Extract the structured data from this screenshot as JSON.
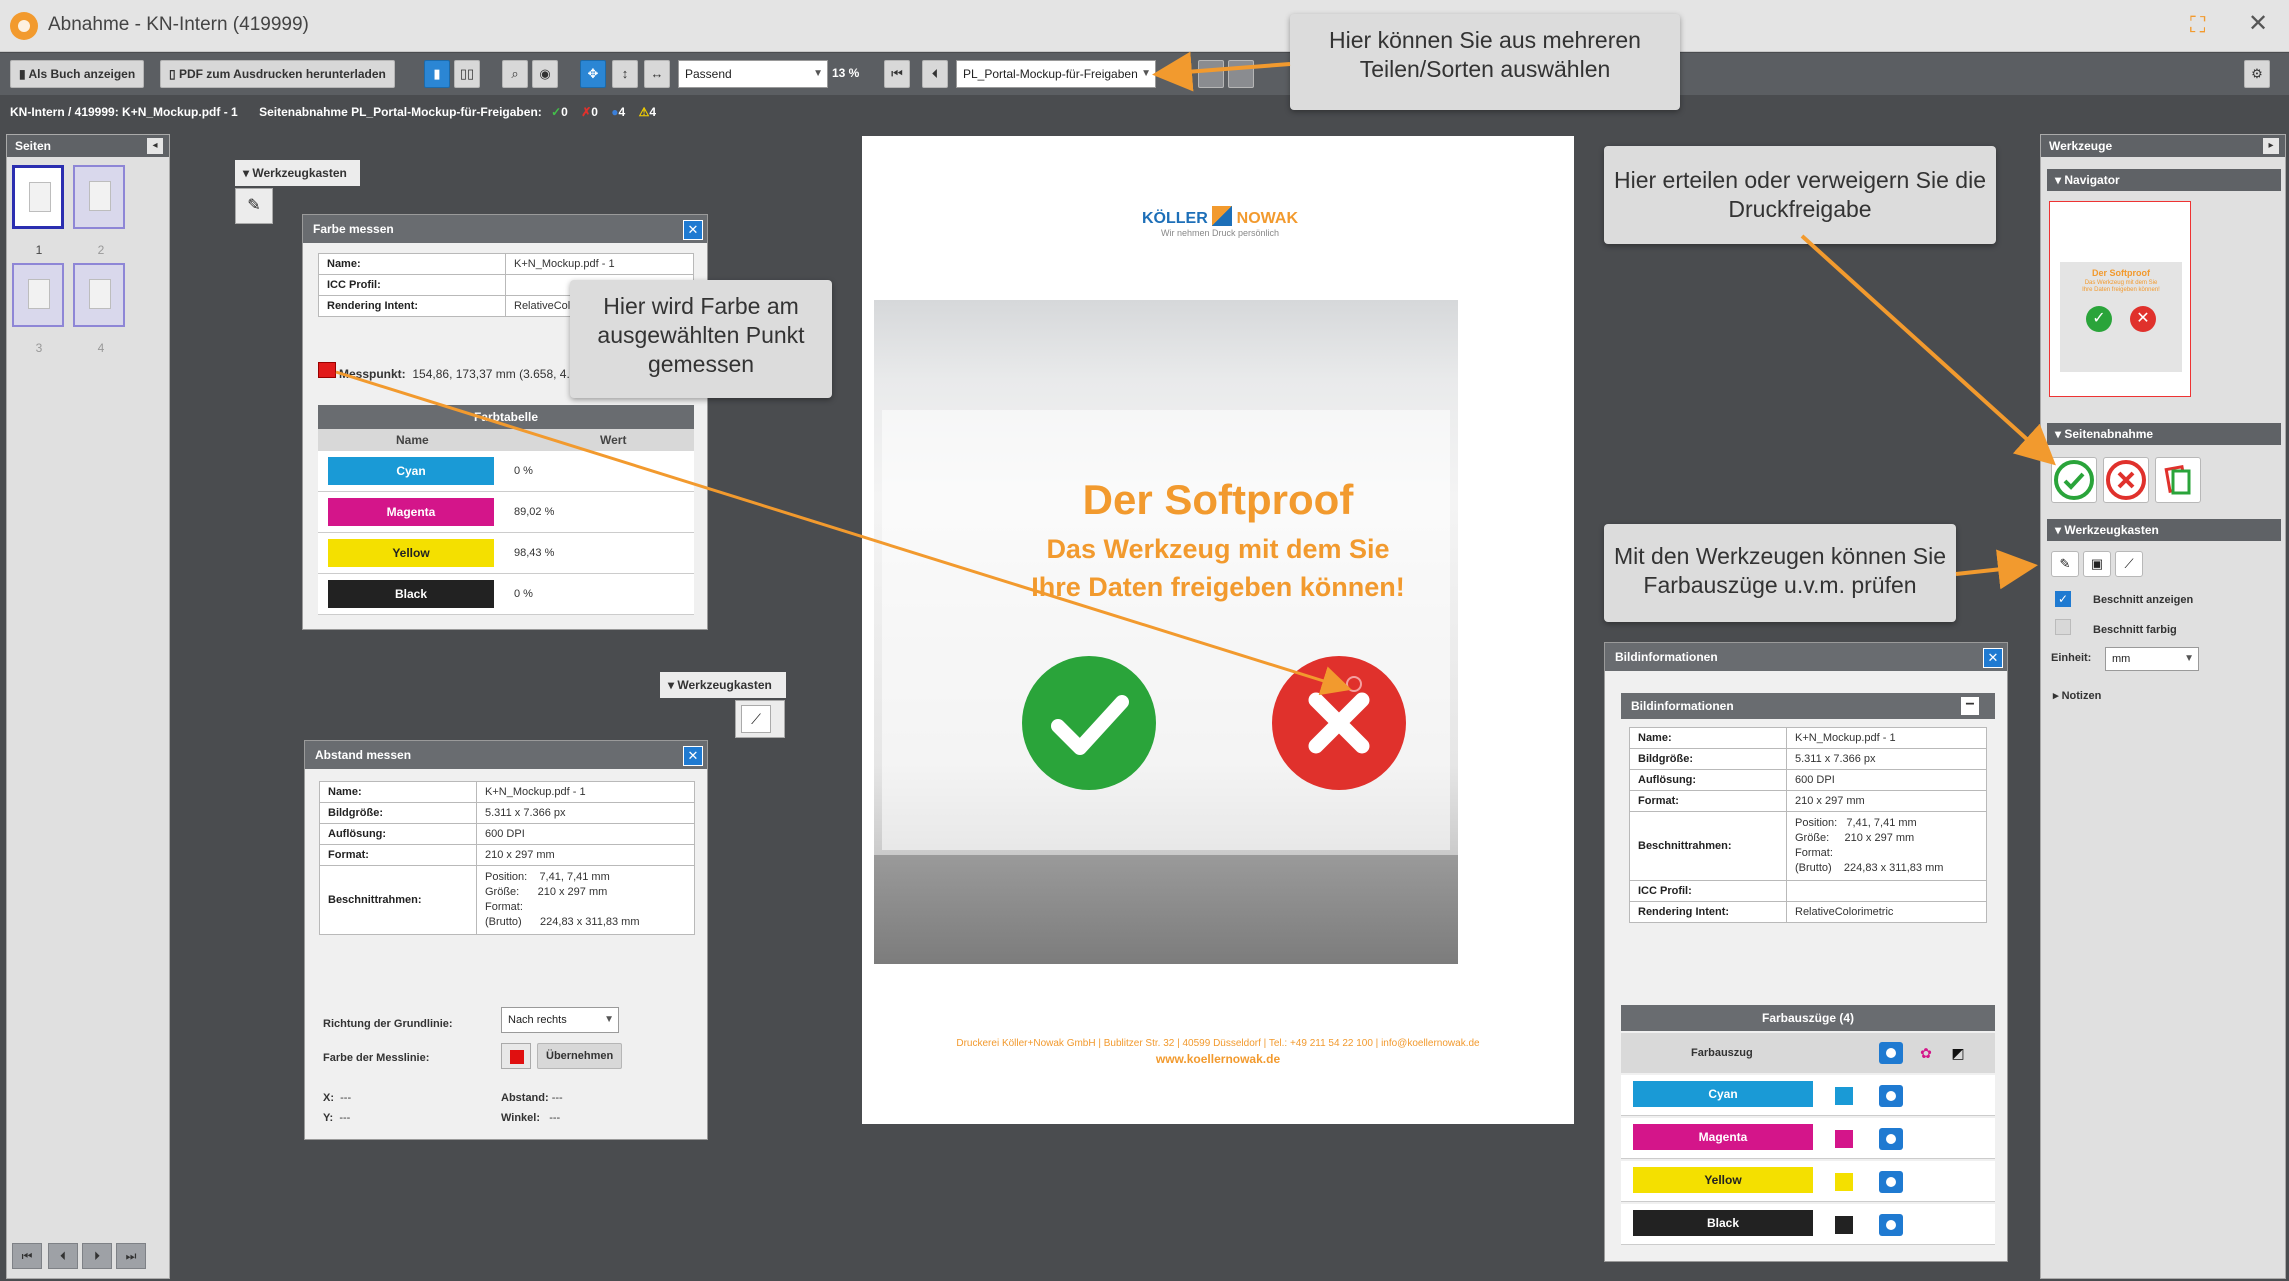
{
  "window": {
    "title": "Abnahme - KN-Intern (419999)"
  },
  "toolbar": {
    "book_view": "Als Buch anzeigen",
    "pdf_download": "PDF zum Ausdrucken herunterladen",
    "fit_select": "Passend",
    "zoom": "13 %",
    "part_select": "PL_Portal-Mockup-für-Freigaben"
  },
  "infoline": {
    "file": "KN-Intern / 419999: K+N_Mockup.pdf - 1",
    "approval_label": "Seitenabnahme PL_Portal-Mockup-für-Freigaben:",
    "approved": "0",
    "rejected": "0",
    "pending": "4",
    "warnings": "4"
  },
  "left_panel": {
    "title": "Seiten",
    "pages": [
      "1",
      "2",
      "3",
      "4"
    ]
  },
  "toolbox1": {
    "title": "Werkzeugkasten"
  },
  "toolbox2": {
    "title": "Werkzeugkasten"
  },
  "farbe_messen": {
    "title": "Farbe messen",
    "rows": [
      {
        "k": "Name:",
        "v": "K+N_Mockup.pdf - 1"
      },
      {
        "k": "ICC Profil:",
        "v": ""
      },
      {
        "k": "Rendering Intent:",
        "v": "RelativeColorimetric"
      }
    ],
    "messpunkt_label": "Messpunkt:",
    "messpunkt_value": "154,86, 173,37 mm (3.658, 4.095) px",
    "table_title": "Farbtabelle",
    "col_name": "Name",
    "col_value": "Wert",
    "colors": [
      {
        "name": "Cyan",
        "value": "0 %",
        "hex": "#1a9ad6"
      },
      {
        "name": "Magenta",
        "value": "89,02 %",
        "hex": "#d4158a"
      },
      {
        "name": "Yellow",
        "value": "98,43 %",
        "hex": "#f4e000"
      },
      {
        "name": "Black",
        "value": "0 %",
        "hex": "#222222"
      }
    ]
  },
  "abstand_messen": {
    "title": "Abstand messen",
    "rows": [
      {
        "k": "Name:",
        "v": "K+N_Mockup.pdf - 1"
      },
      {
        "k": "Bildgröße:",
        "v": "5.311 x 7.366 px"
      },
      {
        "k": "Auflösung:",
        "v": "600 DPI"
      },
      {
        "k": "Format:",
        "v": "210 x 297 mm"
      }
    ],
    "beschnitt_label": "Beschnittrahmen:",
    "beschnitt": {
      "pos_k": "Position:",
      "pos_v": "7,41, 7,41 mm",
      "size_k": "Größe:",
      "size_v": "210 x 297 mm",
      "fmt_k": "Format:",
      "fmt_k2": "(Brutto)",
      "fmt_v": "224,83 x 311,83 mm"
    },
    "direction_label": "Richtung der Grundlinie:",
    "direction_value": "Nach rechts",
    "line_color_label": "Farbe der Messlinie:",
    "apply_button": "Übernehmen",
    "x_label": "X:",
    "x_value": "---",
    "y_label": "Y:",
    "y_value": "---",
    "distance_label": "Abstand:",
    "distance_value": "---",
    "angle_label": "Winkel:",
    "angle_value": "---"
  },
  "document": {
    "brand_left": "KÖLLER",
    "brand_right": "NOWAK",
    "tagline": "Wir nehmen Druck persönlich",
    "headline": "Der Softproof",
    "subline1": "Das Werkzeug mit dem Sie",
    "subline2": "Ihre Daten freigeben können!",
    "footer1": "Druckerei Köller+Nowak GmbH | Bublitzer Str. 32 | 40599 Düsseldorf | Tel.: +49 211 54 22 100 | info@koellernowak.de",
    "footer2": "www.koellernowak.de"
  },
  "callouts": {
    "parts": "Hier können Sie aus mehreren Teilen/Sorten auswählen",
    "color": "Hier wird Farbe am ausgewählten Punkt gemessen",
    "approval": "Hier erteilen oder verweigern Sie die Druckfreigabe",
    "tools": "Mit den Werkzeugen können Sie Farbauszüge u.v.m. prüfen"
  },
  "right_panel": {
    "title": "Werkzeuge",
    "navigator": "Navigator",
    "nav_headline": "Der Softproof",
    "nav_sub": "Das Werkzeug mit dem Sie Ihre Daten freigeben können!",
    "approval": "Seitenabnahme",
    "toolbox": "Werkzeugkasten",
    "show_bleed": "Beschnitt anzeigen",
    "bleed_color": "Beschnitt farbig",
    "unit_label": "Einheit:",
    "unit_value": "mm",
    "notes": "Notizen"
  },
  "bildinfo": {
    "title": "Bildinformationen",
    "section": "Bildinformationen",
    "rows": [
      {
        "k": "Name:",
        "v": "K+N_Mockup.pdf - 1"
      },
      {
        "k": "Bildgröße:",
        "v": "5.311 x 7.366 px"
      },
      {
        "k": "Auflösung:",
        "v": "600 DPI"
      },
      {
        "k": "Format:",
        "v": "210 x 297 mm"
      }
    ],
    "beschnitt_label": "Beschnittrahmen:",
    "beschnitt": {
      "pos_k": "Position:",
      "pos_v": "7,41, 7,41 mm",
      "size_k": "Größe:",
      "size_v": "210 x 297 mm",
      "fmt_k": "Format:",
      "fmt_k2": "(Brutto)",
      "fmt_v": "224,83 x 311,83 mm"
    },
    "icc_label": "ICC Profil:",
    "icc_value": "",
    "intent_label": "Rendering Intent:",
    "intent_value": "RelativeColorimetric",
    "separations_title": "Farbauszüge (4)",
    "separation_col": "Farbauszug",
    "separations": [
      {
        "name": "Cyan",
        "hex": "#1a9ad6"
      },
      {
        "name": "Magenta",
        "hex": "#d4158a"
      },
      {
        "name": "Yellow",
        "hex": "#f4e000"
      },
      {
        "name": "Black",
        "hex": "#222222"
      }
    ]
  },
  "colors": {
    "accent": "#f29a2e",
    "blue": "#1f7ad1",
    "green": "#2aa43a",
    "red": "#e0312c"
  }
}
